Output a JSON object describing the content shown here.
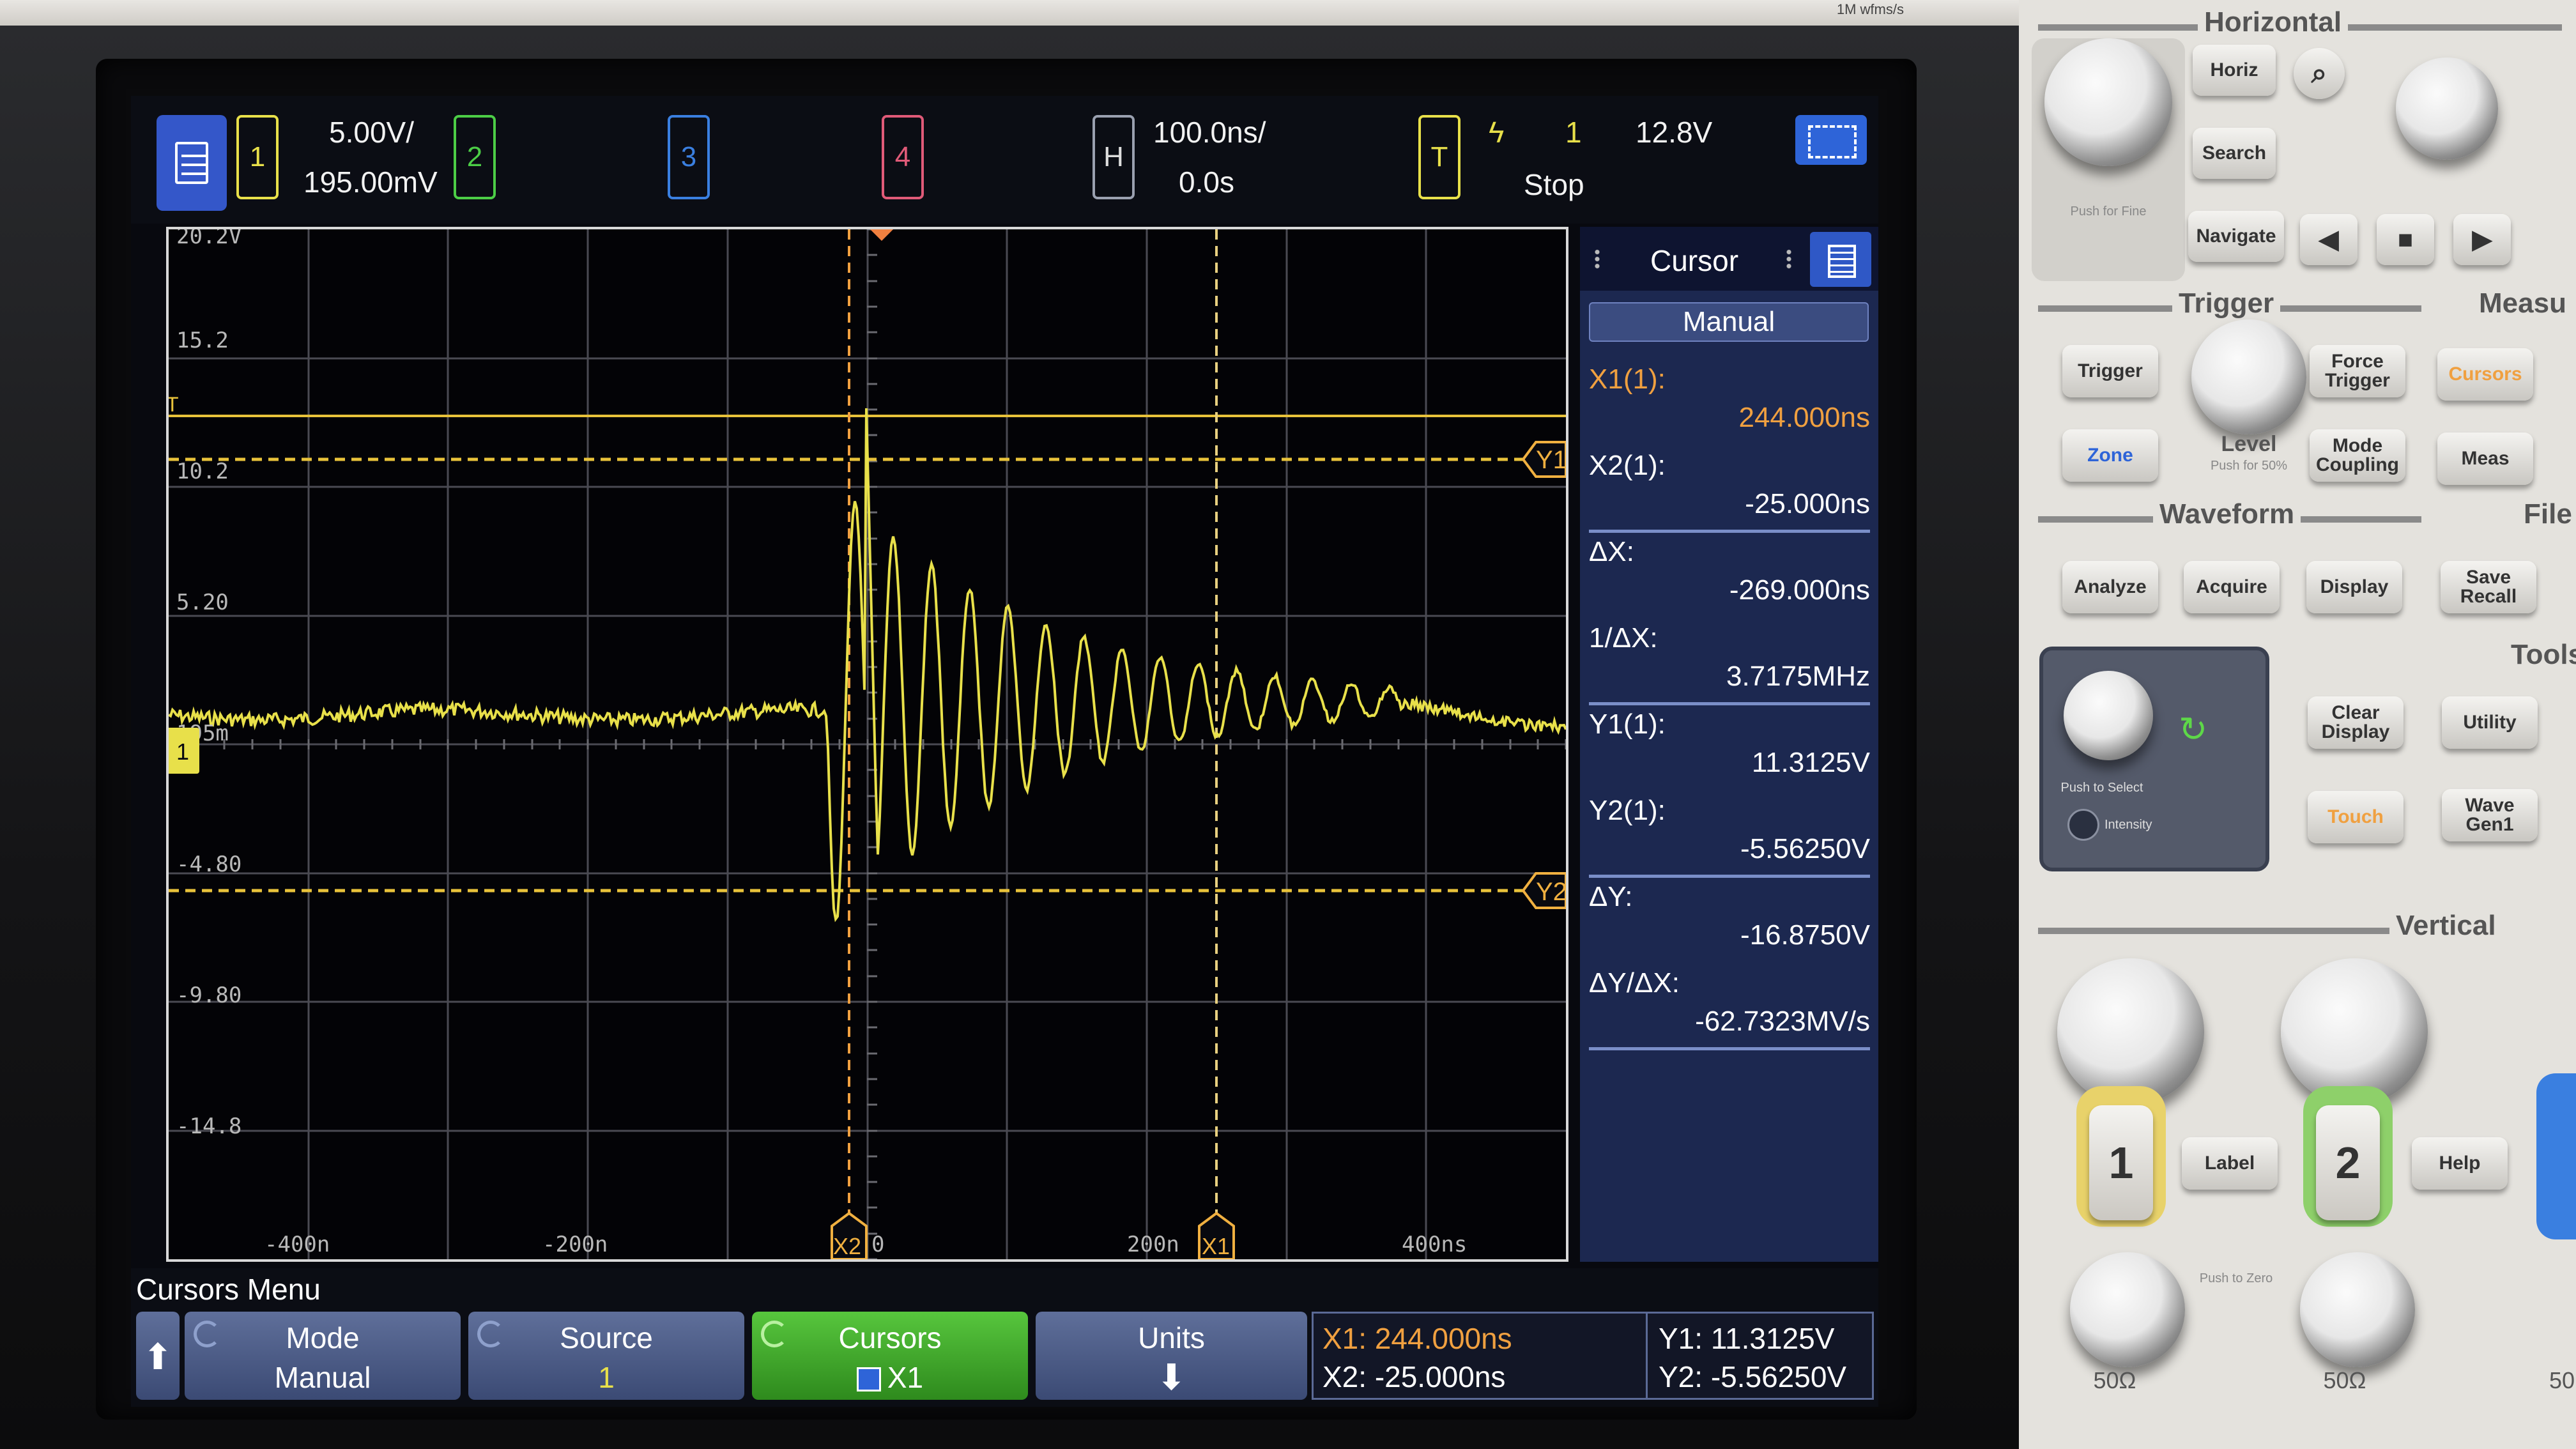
{
  "bezel": {
    "brand_text": "1M wfms/s"
  },
  "topbar": {
    "ch1_label": "1",
    "ch1_scale": "5.00V/",
    "ch1_offset": "195.00mV",
    "ch2_label": "2",
    "ch3_label": "3",
    "ch4_label": "4",
    "h_label": "H",
    "timebase": "100.0ns/",
    "delay": "0.0s",
    "t_label": "T",
    "trigger_source": "1",
    "trigger_level": "12.8V",
    "run_state": "Stop"
  },
  "graticule": {
    "y_ticks": [
      "20.2V",
      "15.2",
      "10.2",
      "5.20",
      "195m",
      "-4.80",
      "-9.80",
      "-14.8"
    ],
    "x_ticks": [
      "-400n",
      "-200n",
      "0",
      "200n",
      "400ns"
    ],
    "cursor_markers": {
      "x1": "X1",
      "x2": "X2",
      "y1": "Y1",
      "y2": "Y2",
      "trigger": "T",
      "ground": "1"
    }
  },
  "cursor_panel": {
    "title": "Cursor",
    "mode": "Manual",
    "rows": [
      {
        "label": "X1(1):",
        "value": "244.000ns",
        "accent": "#f0a040"
      },
      {
        "label": "X2(1):",
        "value": "-25.000ns"
      },
      {
        "label": "ΔX:",
        "value": "-269.000ns"
      },
      {
        "label": "1/ΔX:",
        "value": "3.7175MHz"
      },
      {
        "label": "Y1(1):",
        "value": "11.3125V"
      },
      {
        "label": "Y2(1):",
        "value": "-5.56250V"
      },
      {
        "label": "ΔY:",
        "value": "-16.8750V"
      },
      {
        "label": "ΔY/ΔX:",
        "value": "-62.7323MV/s"
      }
    ]
  },
  "softkeys": {
    "menu_title": "Cursors Menu",
    "mode_label": "Mode",
    "mode_value": "Manual",
    "source_label": "Source",
    "source_value": "1",
    "cursors_label": "Cursors",
    "cursors_value": "X1",
    "units_label": "Units",
    "readout_x1": "X1: 244.000ns",
    "readout_x2": "X2: -25.000ns",
    "readout_y1": "Y1: 11.3125V",
    "readout_y2": "Y2: -5.56250V"
  },
  "front_panel": {
    "horizontal": "Horizontal",
    "horiz": "Horiz",
    "search": "Search",
    "navigate": "Navigate",
    "push_for_fine": "Push for Fine",
    "trigger_section": "Trigger",
    "trigger_btn": "Trigger",
    "force_trigger": "Force Trigger",
    "zone": "Zone",
    "level": "Level",
    "push_for_50": "Push for 50%",
    "mode_coupling": "Mode Coupling",
    "measure_section": "Measu",
    "cursors_btn": "Cursors",
    "meas_btn": "Meas",
    "waveform_section": "Waveform",
    "file_section": "File",
    "analyze": "Analyze",
    "acquire": "Acquire",
    "display": "Display",
    "save_recall": "Save Recall",
    "tools_section": "Tools",
    "push_to_select": "Push to Select",
    "intensity": "Intensity",
    "clear_display": "Clear Display",
    "utility": "Utility",
    "touch": "Touch",
    "wave_gen": "Wave Gen1",
    "vertical_section": "Vertical",
    "ch1_key": "1",
    "ch2_key": "2",
    "label_btn": "Label",
    "help_btn": "Help",
    "push_to_zero": "Push to Zero",
    "imp1": "50Ω",
    "imp2": "50Ω",
    "imp3": "50"
  },
  "colors": {
    "ch1": "#e8e04a",
    "ch2": "#4ccd46",
    "ch3": "#3a7fe0",
    "ch4": "#e05a78",
    "cursor_x": "#f0a040",
    "cursor_y": "#e8c23a",
    "grid": "#6a6a70",
    "panel_bg": "#1c2850"
  }
}
